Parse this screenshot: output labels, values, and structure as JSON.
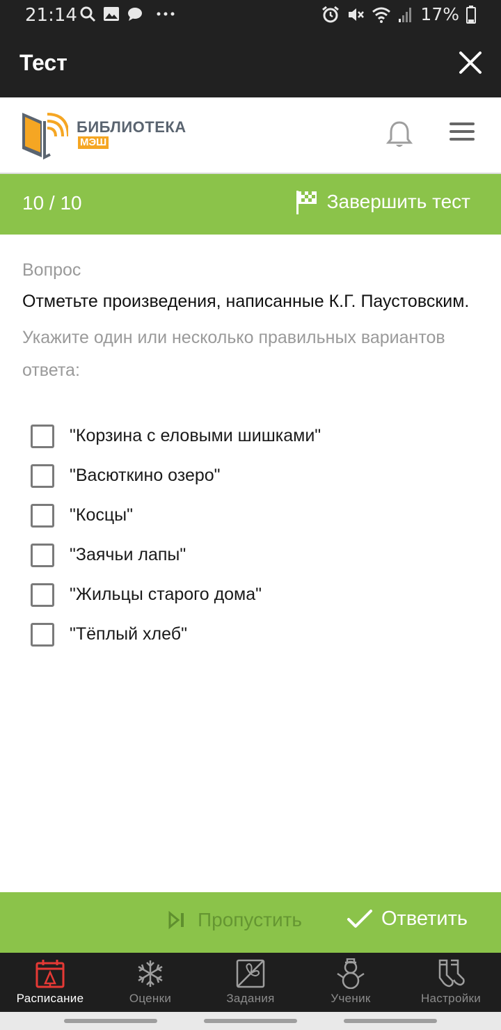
{
  "status_bar": {
    "time": "21:14",
    "battery": "17%",
    "left_icons": [
      "search-icon",
      "image-icon",
      "chat-icon",
      "more-dots-icon"
    ],
    "right_icons": [
      "alarm-icon",
      "mute-icon",
      "wifi-icon",
      "signal-icon",
      "battery-icon"
    ]
  },
  "app_bar": {
    "title": "Тест"
  },
  "brand": {
    "name": "БИБЛИОТЕКА",
    "sub": "МЭШ",
    "colors": {
      "orange": "#f5a623",
      "gray": "#5a6470"
    }
  },
  "progress": {
    "count": "10 / 10",
    "finish_label": "Завершить тест"
  },
  "question": {
    "label": "Вопрос",
    "text": "Отметьте произведения, написанные К.Г. Паустовским.",
    "hint": "Укажите один или несколько правильных вариантов ответа:"
  },
  "options": [
    {
      "label": "\"Корзина с еловыми шишками\"",
      "checked": false
    },
    {
      "label": "\"Васюткино озеро\"",
      "checked": false
    },
    {
      "label": "\"Косцы\"",
      "checked": false
    },
    {
      "label": "\"Заячьи лапы\"",
      "checked": false
    },
    {
      "label": "\"Жильцы старого дома\"",
      "checked": false
    },
    {
      "label": "\"Тёплый хлеб\"",
      "checked": false
    }
  ],
  "actions": {
    "skip_label": "Пропустить",
    "answer_label": "Ответить"
  },
  "nav": {
    "items": [
      {
        "label": "Расписание",
        "icon": "calendar-icon",
        "active": true
      },
      {
        "label": "Оценки",
        "icon": "snowflake-icon",
        "active": false
      },
      {
        "label": "Задания",
        "icon": "gift-icon",
        "active": false
      },
      {
        "label": "Ученик",
        "icon": "snowman-icon",
        "active": false
      },
      {
        "label": "Настройки",
        "icon": "socks-icon",
        "active": false
      }
    ]
  },
  "colors": {
    "accent_green": "#8bc34a",
    "dark": "#212121",
    "active_red": "#e53935"
  }
}
